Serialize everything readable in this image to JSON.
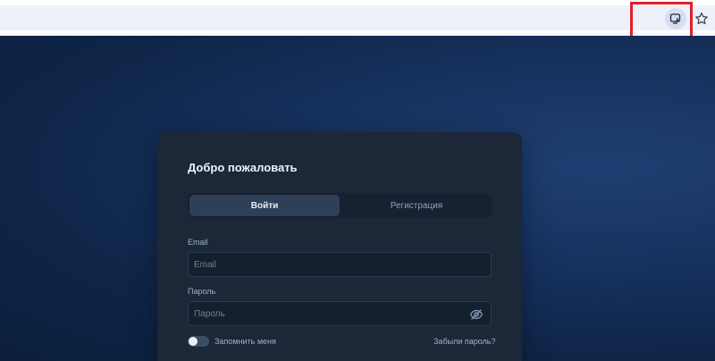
{
  "browser": {
    "install_icon": "install-app-icon",
    "bookmark_icon": "star-icon"
  },
  "card": {
    "title": "Добро пожаловать",
    "tabs": [
      {
        "label": "Войти",
        "active": true
      },
      {
        "label": "Регистрация",
        "active": false
      }
    ],
    "email": {
      "label": "Email",
      "placeholder": "Email",
      "value": ""
    },
    "password": {
      "label": "Пароль",
      "placeholder": "Пароль",
      "value": "",
      "toggle_icon": "eye-off-icon"
    },
    "remember_label": "Запомнить меня",
    "remember_checked": false,
    "forgot_label": "Забыли пароль?"
  },
  "colors": {
    "accent_highlight": "#e0202a",
    "card_bg": "#1c2737",
    "page_bg": "#163260"
  }
}
